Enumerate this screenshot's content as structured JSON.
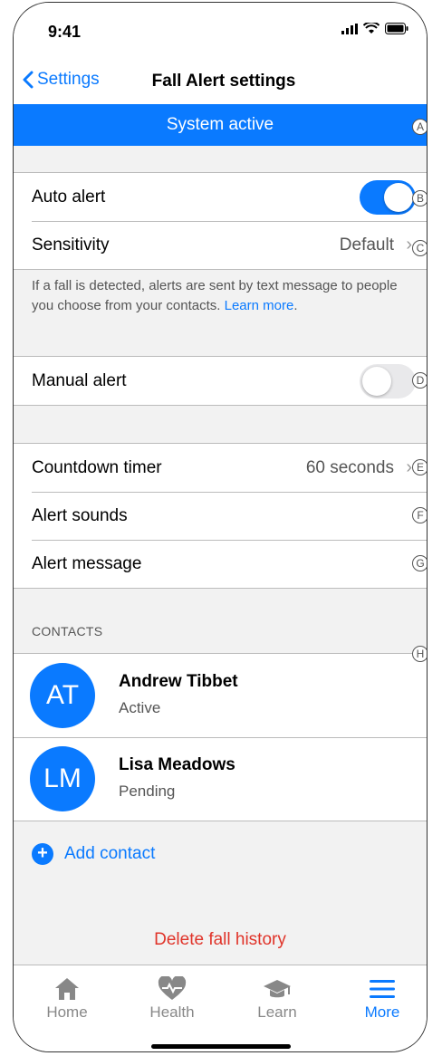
{
  "status_bar": {
    "time": "9:41"
  },
  "nav": {
    "back_label": "Settings",
    "title": "Fall Alert settings"
  },
  "banner": {
    "text": "System active"
  },
  "markers": [
    "A",
    "B",
    "C",
    "D",
    "E",
    "F",
    "G",
    "H"
  ],
  "auto_group": {
    "auto_alert_label": "Auto alert",
    "auto_alert_on": true,
    "sensitivity_label": "Sensitivity",
    "sensitivity_value": "Default",
    "note_text": "If a fall is detected, alerts are sent by text message to people you choose from your contacts.",
    "note_link": "Learn more"
  },
  "manual_group": {
    "manual_alert_label": "Manual alert",
    "manual_alert_on": false
  },
  "timer_group": {
    "countdown_label": "Countdown timer",
    "countdown_value": "60 seconds",
    "sounds_label": "Alert sounds",
    "message_label": "Alert message"
  },
  "contacts": {
    "header": "CONTACTS",
    "items": [
      {
        "initials": "AT",
        "name": "Andrew Tibbet",
        "status": "Active"
      },
      {
        "initials": "LM",
        "name": "Lisa Meadows",
        "status": "Pending"
      }
    ],
    "add_label": "Add contact"
  },
  "delete_label": "Delete fall history",
  "tabs": [
    {
      "label": "Home",
      "icon": "house-icon",
      "active": false
    },
    {
      "label": "Health",
      "icon": "heart-pulse-icon",
      "active": false
    },
    {
      "label": "Learn",
      "icon": "graduation-cap-icon",
      "active": false
    },
    {
      "label": "More",
      "icon": "menu-icon",
      "active": true
    }
  ],
  "colors": {
    "accent": "#0a7aff",
    "danger": "#e0342a",
    "background": "#f2f2f2"
  }
}
